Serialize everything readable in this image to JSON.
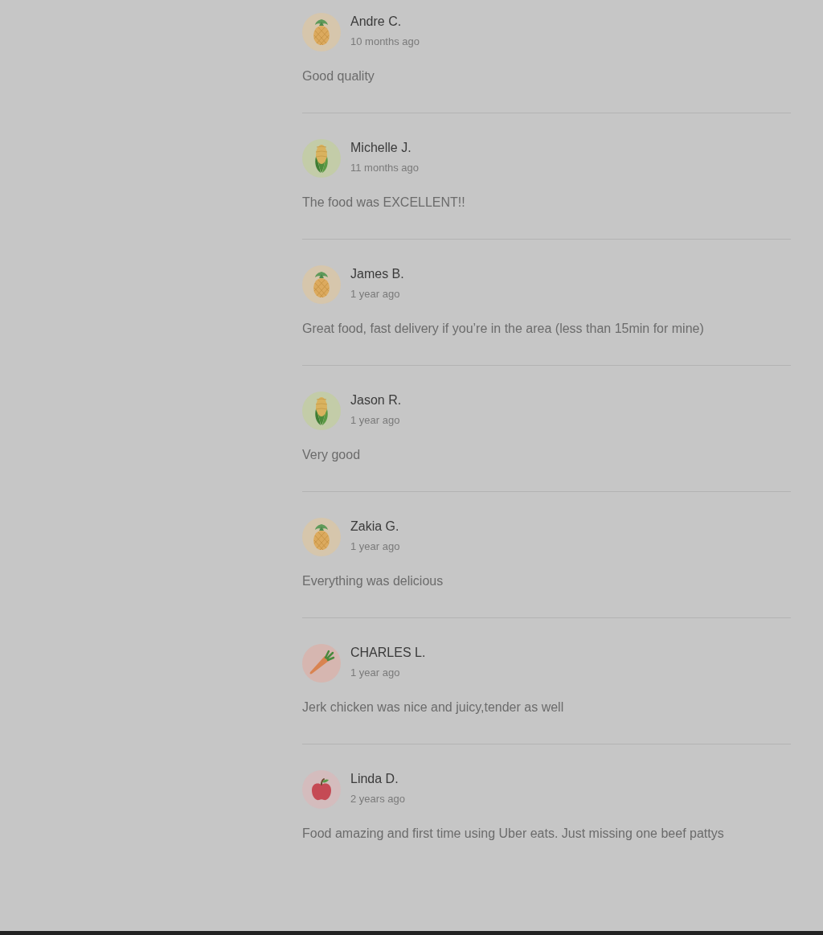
{
  "reviews": [
    {
      "kind": "pineapple",
      "name": "Andre C.",
      "time": "10 months ago",
      "text": "Good quality"
    },
    {
      "kind": "corn",
      "name": "Michelle J.",
      "time": "11 months ago",
      "text": "The food was EXCELLENT!!"
    },
    {
      "kind": "pineapple",
      "name": "James B.",
      "time": "1 year ago",
      "text": "Great food, fast delivery if you’re in the area (less than 15min for mine)"
    },
    {
      "kind": "corn",
      "name": "Jason R.",
      "time": "1 year ago",
      "text": "Very good"
    },
    {
      "kind": "pineapple",
      "name": "Zakia G.",
      "time": "1 year ago",
      "text": "Everything was delicious"
    },
    {
      "kind": "carrot",
      "name": "CHARLES L.",
      "time": "1 year ago",
      "text": "Jerk chicken was nice and juicy,tender as well"
    },
    {
      "kind": "apple",
      "name": "Linda D.",
      "time": "2 years ago",
      "text": "Food amazing and first time using Uber eats. Just missing one beef pattys"
    }
  ]
}
